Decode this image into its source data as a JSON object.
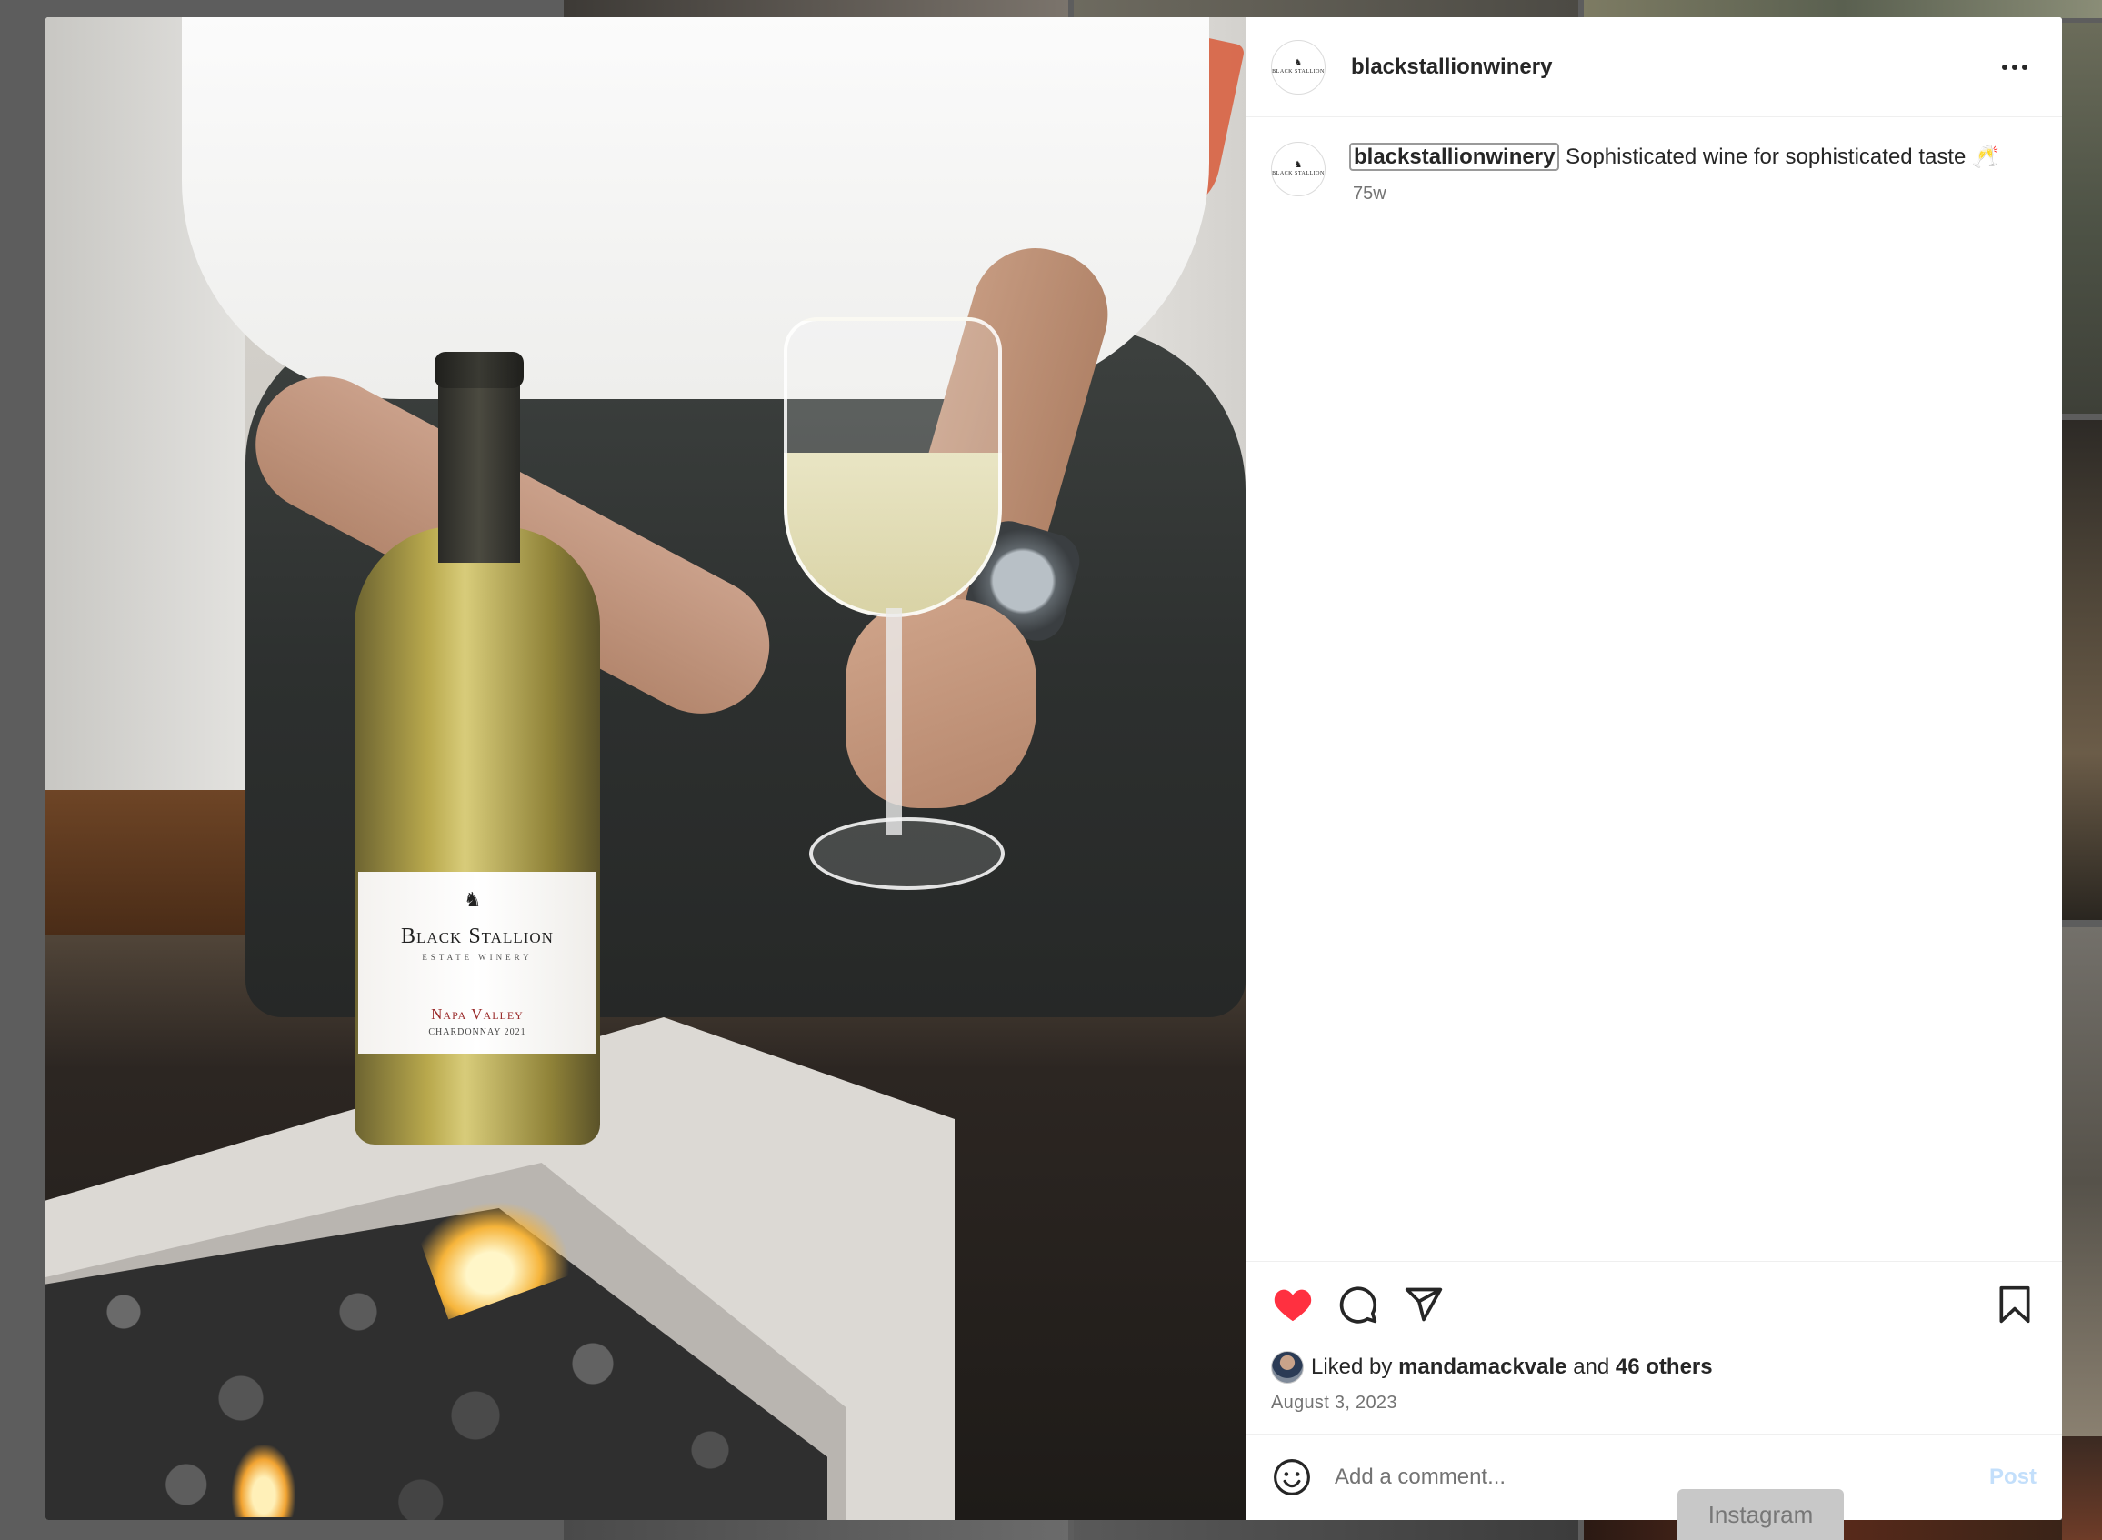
{
  "post": {
    "username": "blackstallionwinery",
    "caption_text": "Sophisticated wine for sophisticated taste 🥂",
    "time_ago": "75w",
    "liked_by_prefix": "Liked by",
    "liked_by_user": "mandamackvale",
    "liked_by_and": "and",
    "liked_by_others": "46 others",
    "date": "August 3, 2023",
    "liked": true
  },
  "image_label": {
    "brand": "Black Stallion",
    "estate": "ESTATE WINERY",
    "region": "Napa Valley",
    "varietal": "CHARDONNAY 2021"
  },
  "avatar_text": "BLACK STALLION",
  "actions": {
    "like_icon": "heart-icon",
    "comment_icon": "comment-icon",
    "share_icon": "share-icon",
    "save_icon": "bookmark-icon",
    "emoji_icon": "emoji-icon"
  },
  "comment": {
    "placeholder": "Add a comment...",
    "post_label": "Post"
  },
  "tooltip": "Instagram",
  "colors": {
    "like_red": "#ff3040",
    "post_button_disabled": "#c3dffb",
    "secondary_text": "#737373"
  }
}
